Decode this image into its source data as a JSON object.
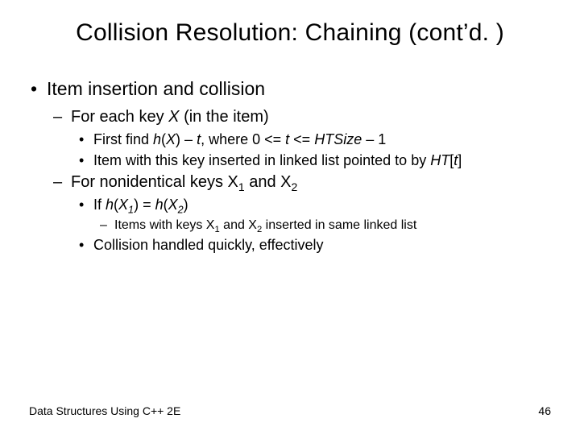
{
  "title": "Collision Resolution: Chaining (cont’d. )",
  "b1": "Item insertion and collision",
  "b2a_pre": "For each key ",
  "b2a_x": "X",
  "b2a_post": " (in the item)",
  "b3a_pre": "First find ",
  "b3a_hx": "h",
  "b3a_paren1": "(",
  "b3a_x": "X",
  "b3a_paren2": ")",
  "b3a_mid1": " – ",
  "b3a_t1": "t",
  "b3a_mid2": ", where 0 <= ",
  "b3a_t2": "t",
  "b3a_mid3": " <= ",
  "b3a_hts": "HTSize",
  "b3a_end": " – 1",
  "b3b_pre": "Item with this key inserted in linked list pointed to by ",
  "b3b_ht": "HT",
  "b3b_br1": "[",
  "b3b_t": "t",
  "b3b_br2": "]",
  "b2b_pre": "For nonidentical keys X",
  "b2b_s1": "1",
  "b2b_mid": " and X",
  "b2b_s2": "2",
  "b3c_pre": "If ",
  "b3c_h1": "h",
  "b3c_p1": "(",
  "b3c_x1": "X",
  "b3c_s1": "1",
  "b3c_p2": ")",
  "b3c_eq": " = ",
  "b3c_h2": "h",
  "b3c_p3": "(",
  "b3c_x2": "X",
  "b3c_s2": "2",
  "b3c_p4": ")",
  "b4_pre": "Items with keys X",
  "b4_s1": "1",
  "b4_mid": " and X",
  "b4_s2": "2",
  "b4_end": " inserted in same linked list",
  "b3d": "Collision handled quickly, effectively",
  "footer_left": "Data Structures Using C++ 2E",
  "footer_right": "46"
}
